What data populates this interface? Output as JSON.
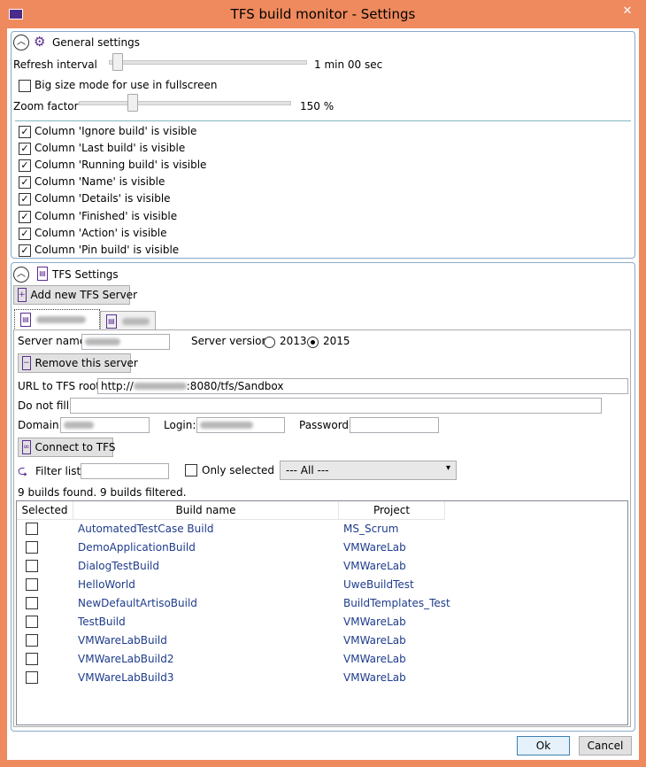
{
  "window": {
    "title": "TFS build monitor - Settings",
    "close": "✕"
  },
  "general": {
    "header": "General settings",
    "refresh_label": "Refresh interval",
    "refresh_value": "1 min 00 sec",
    "big_size_label": "Big size mode for use in fullscreen",
    "zoom_label": "Zoom factor",
    "zoom_value": "150 %",
    "columns": [
      "Column 'Ignore build' is visible",
      "Column 'Last build' is visible",
      "Column 'Running build' is visible",
      "Column 'Name' is visible",
      "Column 'Details' is visible",
      "Column 'Finished' is visible",
      "Column 'Action' is visible",
      "Column 'Pin build' is visible"
    ]
  },
  "tfs": {
    "header": "TFS Settings",
    "add_server": "Add new TFS Server",
    "server_name_label": "Server name:",
    "server_version_label": "Server version:",
    "version_2013": "2013",
    "version_2015": "2015",
    "remove_server": "Remove this server",
    "url_label": "URL to TFS root:",
    "url_prefix": "http://",
    "url_suffix": ":8080/tfs/Sandbox",
    "do_not_fill_label": "Do not fill:",
    "domain_label": "Domain:",
    "login_label": "Login:",
    "password_label": "Password:",
    "connect": "Connect to TFS",
    "filter_label": "Filter list:",
    "only_selected": "Only selected",
    "filter_select": "--- All ---",
    "status": "9 builds found. 9 builds filtered.",
    "grid_headers": {
      "selected": "Selected",
      "build": "Build name",
      "project": "Project"
    },
    "builds": [
      {
        "name": "AutomatedTestCase Build",
        "project": "MS_Scrum"
      },
      {
        "name": "DemoApplicationBuild",
        "project": "VMWareLab"
      },
      {
        "name": "DialogTestBuild",
        "project": "VMWareLab"
      },
      {
        "name": "HelloWorld",
        "project": "UweBuildTest"
      },
      {
        "name": "NewDefaultArtisoBuild",
        "project": "BuildTemplates_Test"
      },
      {
        "name": "TestBuild",
        "project": "VMWareLab"
      },
      {
        "name": "VMWareLabBuild",
        "project": "VMWareLab"
      },
      {
        "name": "VMWareLabBuild2",
        "project": "VMWareLab"
      },
      {
        "name": "VMWareLabBuild3",
        "project": "VMWareLab"
      }
    ]
  },
  "footer": {
    "ok": "Ok",
    "cancel": "Cancel"
  }
}
